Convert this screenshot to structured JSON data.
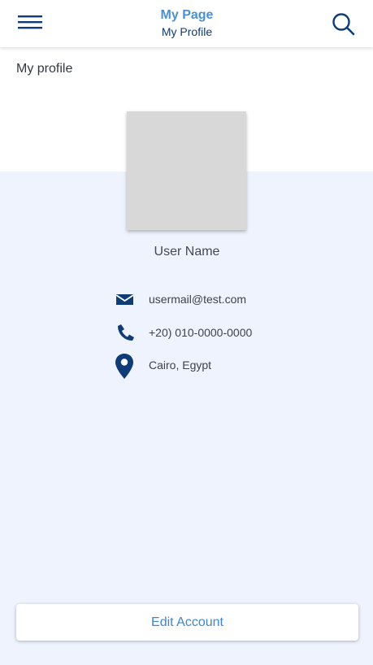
{
  "header": {
    "title": "My Page",
    "subtitle": "My Profile",
    "menu_icon": "hamburger-menu-icon",
    "search_icon": "search-icon"
  },
  "section": {
    "title": "My profile"
  },
  "profile": {
    "user_name": "User Name",
    "email": "usermail@test.com",
    "phone": "+20) 010-0000-0000",
    "location": "Cairo, Egypt"
  },
  "actions": {
    "edit_label": "Edit Account"
  },
  "colors": {
    "accent": "#4a8fd6",
    "primary_dark": "#0d3c78",
    "background": "#eef3fd",
    "avatar_placeholder": "#d8d8d8"
  }
}
